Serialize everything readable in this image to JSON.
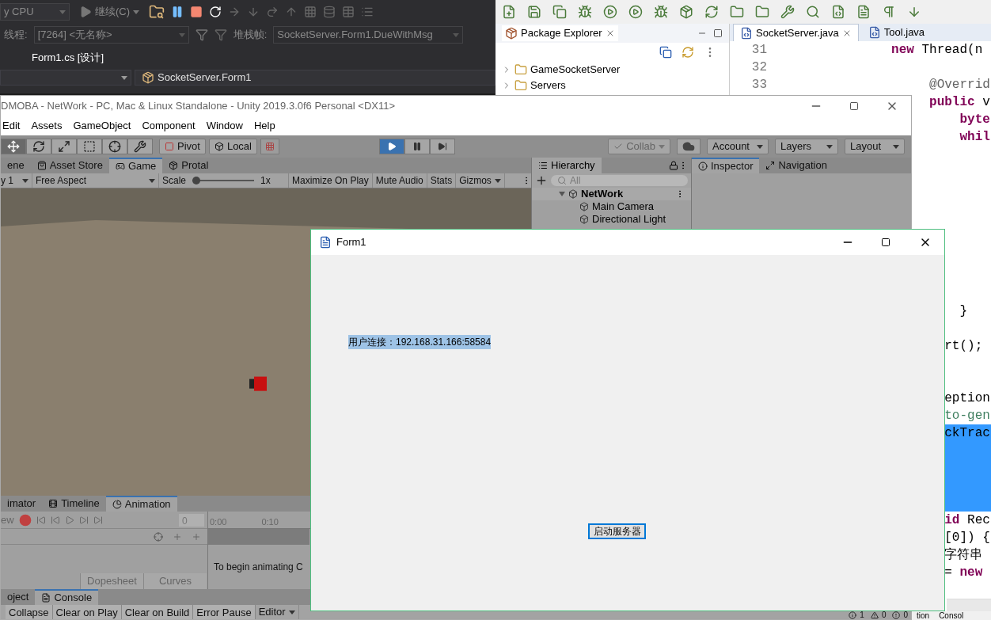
{
  "vs": {
    "toolbar": {
      "platform": "y CPU",
      "continue": "继续(C)"
    },
    "debug_location": {
      "thread_label": "线程:",
      "thread": "[7264] <无名称>",
      "stack_label": "堆栈帧:",
      "stack_frame": "SocketServer.Form1.DueWithMsg"
    },
    "document_tab": "Form1.cs [设计]",
    "nav_bar": {
      "type": "SocketServer.Form1"
    }
  },
  "eclipse": {
    "package_explorer": {
      "title": "Package Explorer",
      "projects": [
        {
          "name": "GameSocketServer",
          "expanded": false
        },
        {
          "name": "Servers",
          "expanded": false
        }
      ]
    },
    "editor_tabs": [
      {
        "label": "SocketServer.java",
        "selected": true
      },
      {
        "label": "Tool.java",
        "selected": false
      }
    ],
    "code_lines": [
      {
        "kind": "code",
        "number": "31",
        "selected": false,
        "tokens": [
          {
            "text": "               new",
            "kind": "keyword"
          },
          {
            "text": " Thread(n",
            "kind": "plain"
          }
        ]
      },
      {
        "kind": "blank",
        "number": "32",
        "selected": false
      },
      {
        "kind": "code",
        "number": "33",
        "selected": false,
        "tokens": [
          {
            "text": "                    @Overrid",
            "kind": "annotation"
          }
        ]
      },
      {
        "kind": "code",
        "selected": false,
        "tokens": [
          {
            "text": "                    public",
            "kind": "keyword"
          },
          {
            "text": " v",
            "kind": "plain"
          }
        ]
      },
      {
        "kind": "code",
        "selected": false,
        "tokens": [
          {
            "text": "                        byte",
            "kind": "keyword"
          }
        ]
      },
      {
        "kind": "code",
        "selected": false,
        "tokens": [
          {
            "text": "                        whil",
            "kind": "keyword"
          }
        ]
      },
      {
        "kind": "blank",
        "selected": false
      },
      {
        "kind": "blank",
        "selected": false
      },
      {
        "kind": "blank",
        "selected": false
      },
      {
        "kind": "blank",
        "selected": false
      },
      {
        "kind": "blank",
        "selected": false
      },
      {
        "kind": "blank",
        "selected": false
      },
      {
        "kind": "blank",
        "selected": false
      },
      {
        "kind": "blank",
        "selected": false
      },
      {
        "kind": "blank",
        "selected": false
      },
      {
        "kind": "code",
        "selected": false,
        "tokens": [
          {
            "text": "                        }",
            "kind": "plain"
          }
        ]
      },
      {
        "kind": "blank",
        "selected": false
      },
      {
        "kind": "code",
        "selected": false,
        "tokens": [
          {
            "text": "                      rt();",
            "kind": "plain"
          }
        ]
      },
      {
        "kind": "blank",
        "selected": false
      },
      {
        "kind": "blank",
        "selected": false
      },
      {
        "kind": "code",
        "selected": false,
        "tokens": [
          {
            "text": "                      eption",
            "kind": "plain"
          }
        ]
      },
      {
        "kind": "code",
        "selected": false,
        "tokens": [
          {
            "text": "                      to-gen",
            "kind": "comment"
          }
        ]
      },
      {
        "kind": "code",
        "selected": true,
        "tokens": [
          {
            "text": "                      ckTrac",
            "kind": "plain"
          }
        ]
      },
      {
        "kind": "blank",
        "selected": true
      },
      {
        "kind": "blank",
        "selected": true
      },
      {
        "kind": "blank",
        "selected": true
      },
      {
        "kind": "blank",
        "selected": true
      },
      {
        "kind": "code",
        "selected": false,
        "tokens": [
          {
            "text": "                      id",
            "kind": "keyword"
          },
          {
            "text": " Rec",
            "kind": "plain"
          }
        ]
      },
      {
        "kind": "code",
        "selected": false,
        "tokens": [
          {
            "text": "                      [0]) {",
            "kind": "plain"
          }
        ]
      },
      {
        "kind": "code",
        "selected": false,
        "tokens": [
          {
            "text": "                      字符串",
            "kind": "plain"
          }
        ]
      },
      {
        "kind": "code",
        "selected": false,
        "tokens": [
          {
            "text": "                      = ",
            "kind": "plain"
          },
          {
            "text": "new",
            "kind": "keyword"
          }
        ]
      }
    ],
    "bottom_tabs": [
      "tion",
      "Consol"
    ]
  },
  "unity": {
    "title": "DMOBA - NetWork - PC, Mac & Linux Standalone - Unity 2019.3.0f6 Personal <DX11>",
    "menu": [
      "Edit",
      "Assets",
      "GameObject",
      "Component",
      "Window",
      "Help"
    ],
    "tools": [
      {
        "selected": true
      },
      {
        "selected": false
      },
      {
        "selected": false
      },
      {
        "selected": false
      },
      {
        "selected": false
      },
      {
        "selected": false
      }
    ],
    "pivot": "Pivot",
    "local": "Local",
    "playback": [
      {
        "selected": true
      },
      {
        "selected": false
      },
      {
        "selected": false
      }
    ],
    "collab": "Collab",
    "account": "Account",
    "layers": "Layers",
    "layout": "Layout",
    "game_panel": {
      "tabs": [
        {
          "label": "ene",
          "selected": false
        },
        {
          "label": "Asset Store",
          "selected": false
        },
        {
          "label": "Game",
          "selected": true
        },
        {
          "label": "Protal",
          "selected": false
        }
      ],
      "display": "y 1",
      "aspect": "Free Aspect",
      "scale_label": "Scale",
      "scale": {
        "level": 0
      },
      "scale_value": "1x",
      "options": [
        {
          "label": "Maximize On Play",
          "on": false
        },
        {
          "label": "Mute Audio",
          "on": false
        },
        {
          "label": "Stats",
          "on": false
        },
        {
          "label": "Gizmos",
          "on": false
        }
      ]
    },
    "hierarchy": {
      "title": "Hierarchy",
      "search_placeholder": "All",
      "items": [
        {
          "name": "NetWork",
          "expanded": true,
          "children": [
            {
              "name": "Main Camera"
            },
            {
              "name": "Directional Light"
            }
          ]
        }
      ]
    },
    "inspector_tabs": [
      {
        "label": "Inspector",
        "selected": true
      },
      {
        "label": "Navigation",
        "selected": false
      }
    ],
    "animation": {
      "tabs": [
        {
          "label": "imator",
          "selected": false
        },
        {
          "label": "Timeline",
          "selected": false
        },
        {
          "label": "Animation",
          "selected": true
        }
      ],
      "preview": "ew",
      "frame": "0",
      "ruler": [
        "0:00",
        "0:10"
      ],
      "message": "To begin animating C",
      "modes": [
        "Dopesheet",
        "Curves"
      ]
    },
    "console": {
      "tabs": [
        {
          "label": "oject",
          "selected": false
        },
        {
          "label": "Console",
          "selected": true
        }
      ],
      "buttons": [
        "Collapse",
        "Clear on Play",
        "Clear on Build",
        "Error Pause"
      ],
      "editor": "Editor",
      "counts": [
        {
          "kind": "info",
          "count": "1"
        },
        {
          "kind": "warning",
          "count": "0"
        },
        {
          "kind": "error",
          "count": "0"
        }
      ]
    }
  },
  "form1": {
    "title": "Form1",
    "label": "用户连接：192.168.31.166:58584",
    "label_highlighted": true,
    "button": "启动服务器"
  }
}
